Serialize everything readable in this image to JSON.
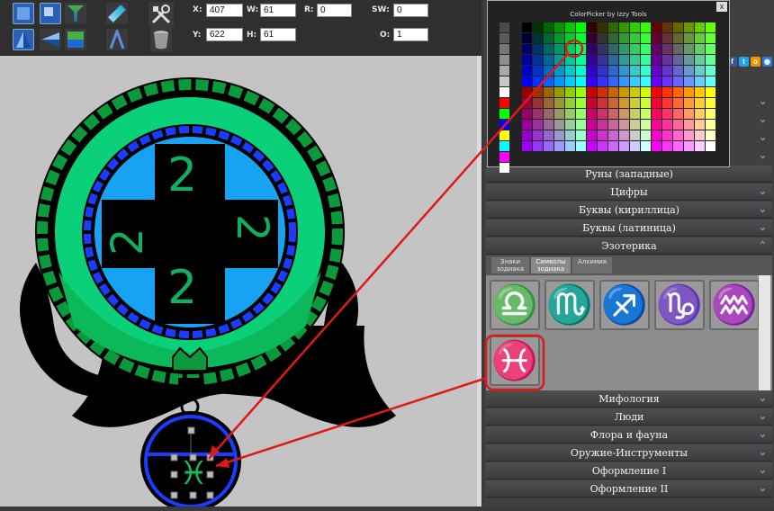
{
  "toolbar": {
    "fields": {
      "x": {
        "label": "X:",
        "value": "407"
      },
      "w": {
        "label": "W:",
        "value": "61"
      },
      "r": {
        "label": "R:",
        "value": "0"
      },
      "sw": {
        "label": "SW:",
        "value": "0"
      },
      "y": {
        "label": "Y:",
        "value": "622"
      },
      "h": {
        "label": "H:",
        "value": "61"
      },
      "o": {
        "label": "O:",
        "value": "1"
      }
    }
  },
  "colorpicker": {
    "title": "ColorPicker by Izzy Tools",
    "close_label": "x",
    "greys": [
      "#4a4a4a",
      "#5a5a5a",
      "#767676",
      "#8e8e8e",
      "#aaaaaa",
      "#c8c8c8",
      "#ffffff",
      "#ff0000",
      "#00ff00",
      "#0000ff",
      "#ffff00",
      "#00ffff",
      "#ff00ff",
      "#ffffff"
    ]
  },
  "panel": {
    "categories_top": [
      {
        "label": "Руны (западные)"
      },
      {
        "label": "Цифры"
      },
      {
        "label": "Буквы (кириллица)"
      },
      {
        "label": "Буквы (латиница)"
      },
      {
        "label": "Эзотерика"
      }
    ],
    "subtabs": [
      {
        "label": "Знаки зодиака"
      },
      {
        "label": "Символы зодиака"
      },
      {
        "label": "Алхимия"
      }
    ],
    "symbols": [
      {
        "glyph": "♎",
        "name": "libra"
      },
      {
        "glyph": "♏",
        "name": "scorpio"
      },
      {
        "glyph": "♐",
        "name": "sagittarius"
      },
      {
        "glyph": "♑",
        "name": "capricorn"
      },
      {
        "glyph": "♒",
        "name": "aquarius"
      },
      {
        "glyph": "♓",
        "name": "pisces"
      }
    ],
    "categories_bottom": [
      {
        "label": "Мифология"
      },
      {
        "label": "Люди"
      },
      {
        "label": "Флора и фауна"
      },
      {
        "label": "Оружие-Инструменты"
      },
      {
        "label": "Оформление I"
      },
      {
        "label": "Оформление II"
      }
    ]
  },
  "canvas": {
    "emblem_digits": [
      "2",
      "2",
      "2",
      "2"
    ],
    "selected_glyph": "♓"
  },
  "colors": {
    "accent_green": "#10a34a",
    "ring_green": "#07c06b",
    "ring_blue": "#1a3cff",
    "sky_blue": "#1aa0f0",
    "annotation_red": "#e01818"
  }
}
